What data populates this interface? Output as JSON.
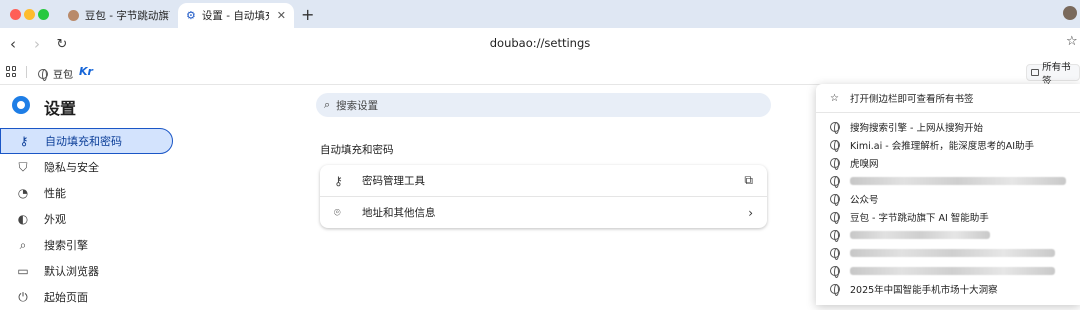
{
  "tabs": [
    {
      "label": "豆包 - 字节跳动旗下 AI 智能助手",
      "icon": "doubao-avatar-icon",
      "active": false
    },
    {
      "label": "设置 - 自动填充和密码",
      "icon": "gear-icon",
      "active": true
    }
  ],
  "toolbar": {
    "url": "doubao://settings"
  },
  "bookmarks_bar": {
    "items": [
      {
        "label": "豆包",
        "icon": "globe-icon"
      },
      {
        "label": "Kr",
        "icon": "kr-logo"
      }
    ],
    "all_bookmarks": "所有书签"
  },
  "settings": {
    "title": "设置",
    "search_placeholder": "搜索设置",
    "nav": [
      {
        "label": "自动填充和密码",
        "icon": "key-icon",
        "active": true
      },
      {
        "label": "隐私与安全",
        "icon": "shield-icon",
        "active": false
      },
      {
        "label": "性能",
        "icon": "speedometer-icon",
        "active": false
      },
      {
        "label": "外观",
        "icon": "palette-icon",
        "active": false
      },
      {
        "label": "搜索引擎",
        "icon": "search-icon",
        "active": false
      },
      {
        "label": "默认浏览器",
        "icon": "browser-window-icon",
        "active": false
      },
      {
        "label": "起始页面",
        "icon": "power-icon",
        "active": false
      }
    ],
    "section_title": "自动填充和密码",
    "rows": [
      {
        "label": "密码管理工具",
        "icon": "key-icon",
        "end_icon": "open-external-icon"
      },
      {
        "label": "地址和其他信息",
        "icon": "location-pin-icon",
        "end_icon": "chevron-right-icon"
      }
    ]
  },
  "bookmarks_popup": {
    "header": "打开侧边栏即可查看所有书签",
    "items": [
      {
        "label": "搜狗搜索引擎 - 上网从搜狗开始"
      },
      {
        "label": "Kimi.ai - 会推理解析，能深度思考的AI助手"
      },
      {
        "label": "虎嗅网"
      },
      {
        "label": ""
      },
      {
        "label": "公众号"
      },
      {
        "label": "豆包 - 字节跳动旗下 AI 智能助手"
      },
      {
        "label": ""
      },
      {
        "label": ""
      },
      {
        "label": ""
      },
      {
        "label": "2025年中国智能手机市场十大洞察"
      }
    ]
  },
  "colors": {
    "titlebar": "#dfe7f3",
    "accent": "#1a56c6",
    "active_nav_bg": "#d3e3fd",
    "search_bg": "#e8eef7"
  }
}
